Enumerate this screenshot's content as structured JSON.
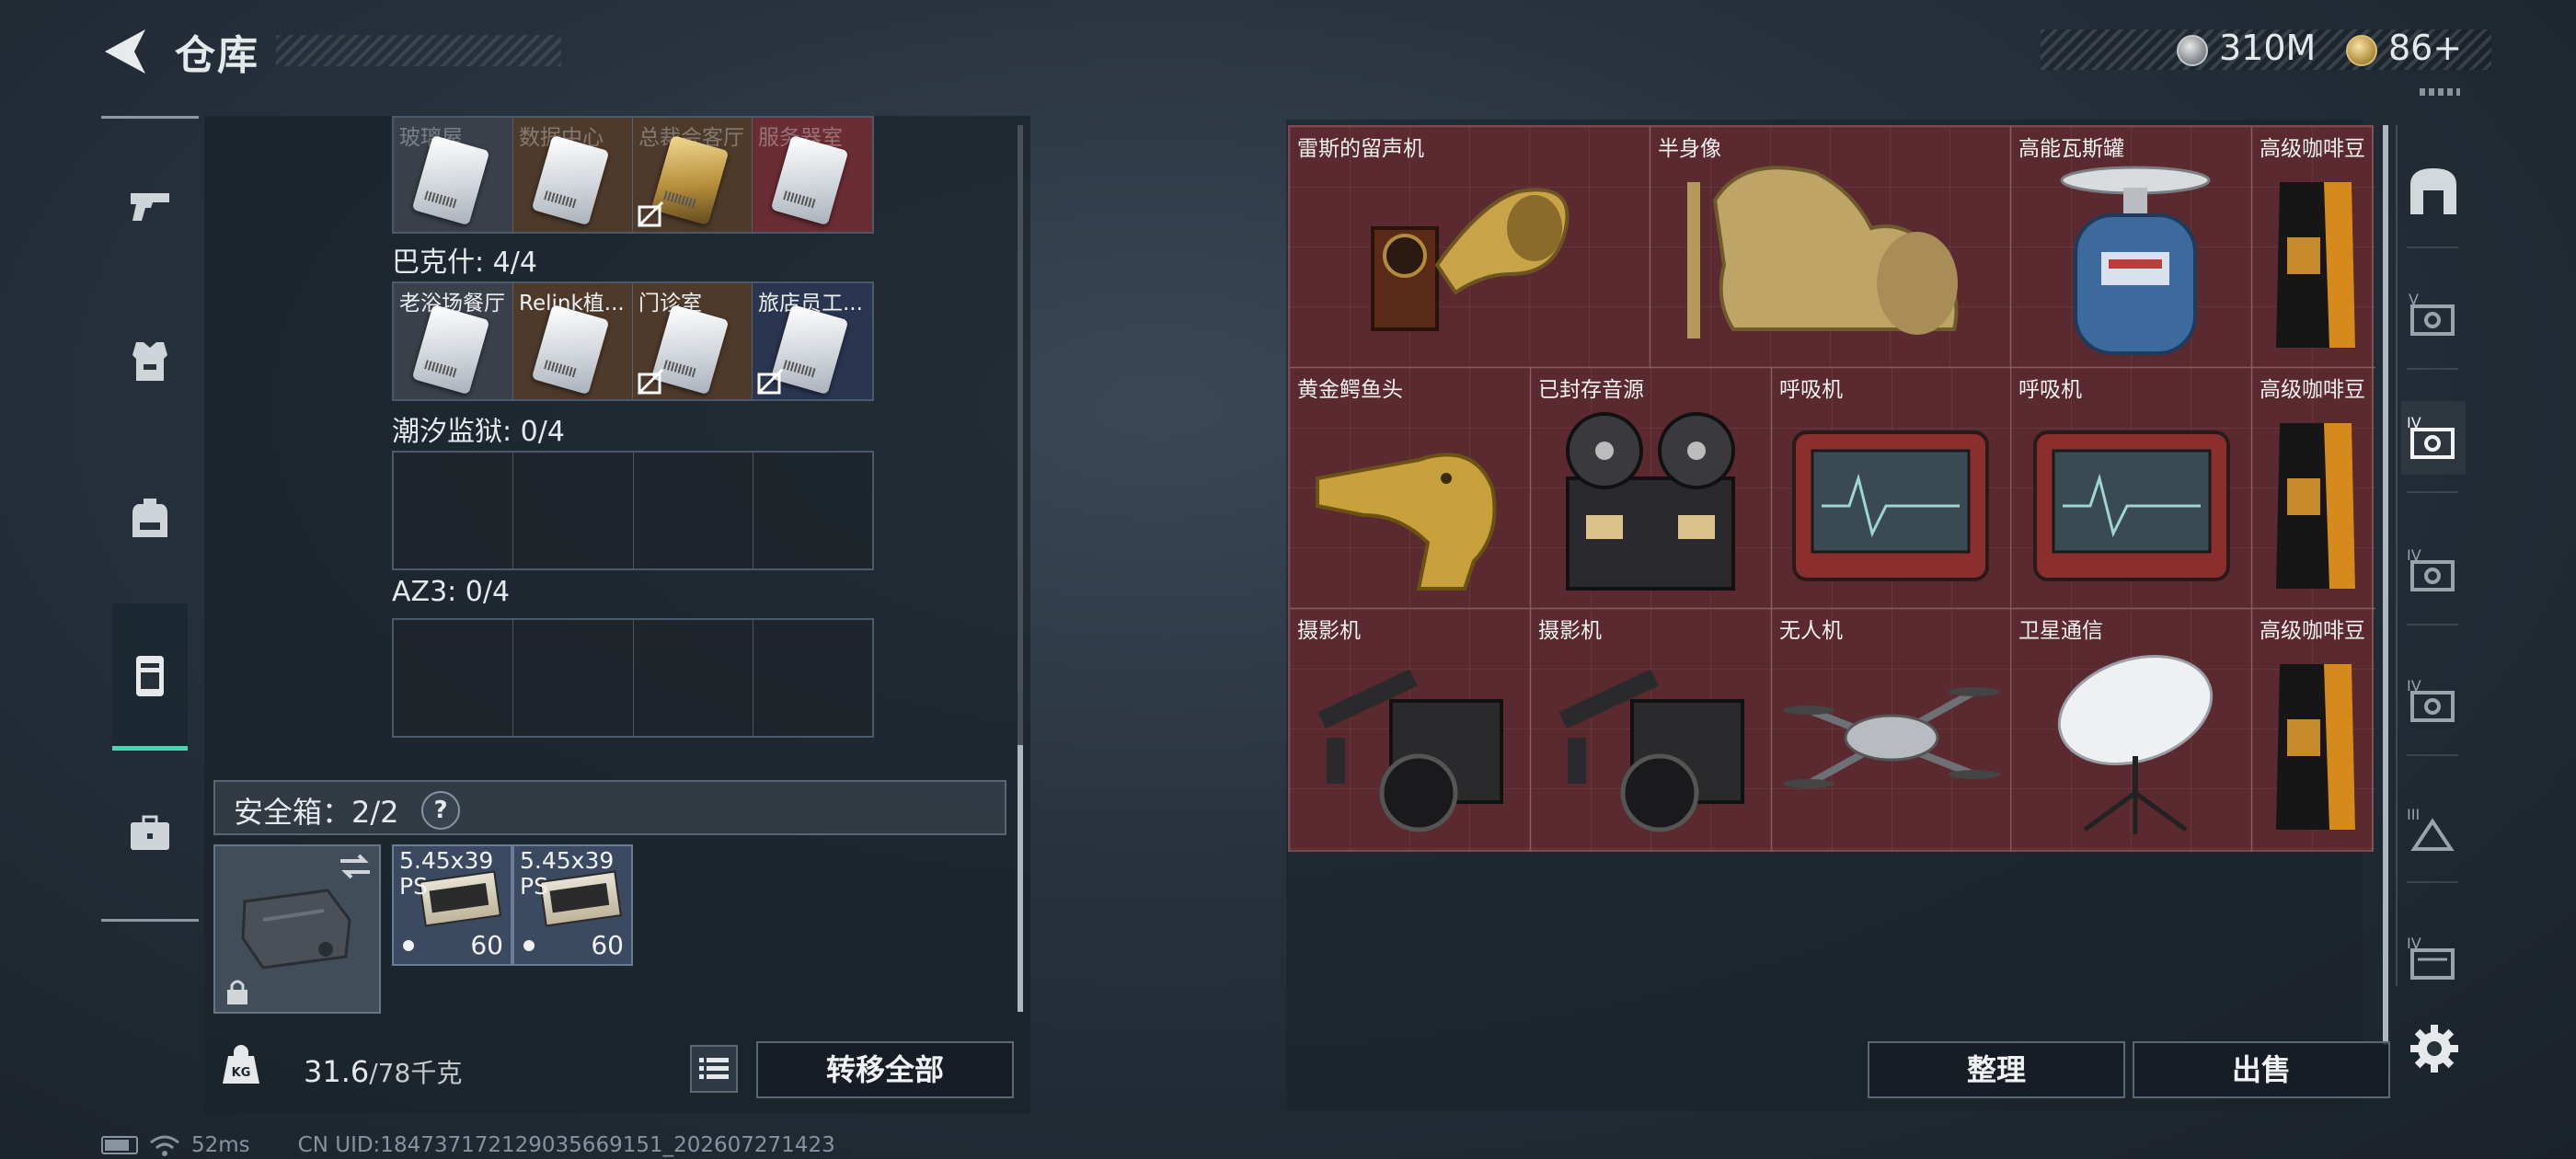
{
  "header": {
    "title": "仓库"
  },
  "currency": {
    "coin_a": "310M",
    "coin_b": "86+"
  },
  "left_nav": [
    "pistol-icon",
    "armor-icon",
    "backpack-icon",
    "container-icon",
    "briefcase-icon"
  ],
  "key_groups": [
    {
      "label": "",
      "cards": [
        {
          "name": "玻璃屋",
          "style": "faded",
          "locked": false
        },
        {
          "name": "数据中心",
          "style": "faded",
          "locked": false
        },
        {
          "name": "总裁会客厅",
          "style": "faded",
          "locked": true
        },
        {
          "name": "服务器室",
          "style": "faded",
          "locked": false
        }
      ]
    },
    {
      "label": "巴克什: 4/4",
      "cards": [
        {
          "name": "老浴场餐厅",
          "locked": false
        },
        {
          "name": "Relink植...",
          "locked": false
        },
        {
          "name": "门诊室",
          "locked": true
        },
        {
          "name": "旅店员工...",
          "locked": true
        }
      ]
    },
    {
      "label": "潮汐监狱: 0/4"
    },
    {
      "label": "AZ3: 0/4"
    }
  ],
  "safebox": {
    "label": "安全箱：2/2",
    "help": "?",
    "ammo": [
      {
        "name": "5.45x39 PS",
        "count": "60"
      },
      {
        "name": "5.45x39 PS",
        "count": "60"
      }
    ]
  },
  "footer": {
    "weight_icon_text": "KG",
    "weight_current": "31.6",
    "weight_max": "/78千克",
    "transfer_all": "转移全部",
    "sort": "整理",
    "sell": "出售"
  },
  "stash_items": [
    {
      "name": "雷斯的留声机",
      "icon": "gramophone-icon"
    },
    {
      "name": "半身像",
      "icon": "bust-icon"
    },
    {
      "name": "高能瓦斯罐",
      "icon": "gas-canister-icon"
    },
    {
      "name": "高级咖啡豆",
      "icon": "coffee-bag-icon"
    },
    {
      "name": "黄金鳄鱼头",
      "icon": "gold-crocodile-head-icon"
    },
    {
      "name": "已封存音源",
      "icon": "tape-recorder-icon"
    },
    {
      "name": "呼吸机",
      "icon": "ventilator-icon"
    },
    {
      "name": "呼吸机",
      "icon": "ventilator-icon"
    },
    {
      "name": "高级咖啡豆",
      "icon": "coffee-bag-icon"
    },
    {
      "name": "摄影机",
      "icon": "camera-icon"
    },
    {
      "name": "摄影机",
      "icon": "camera-icon"
    },
    {
      "name": "无人机",
      "icon": "drone-icon"
    },
    {
      "name": "卫星通信",
      "icon": "satellite-dish-icon"
    },
    {
      "name": "高级咖啡豆",
      "icon": "coffee-bag-icon"
    }
  ],
  "right_tabs": [
    "all-tab",
    "V",
    "IV",
    "IV",
    "IV",
    "III",
    "IV"
  ],
  "status": {
    "ping": "52ms",
    "uid": "CN UID:18473717212903566915​1_202607271423"
  },
  "colors": {
    "accent": "#46d6b2",
    "stash_bg": "#5a2a30",
    "text": "#e6e9ec"
  }
}
